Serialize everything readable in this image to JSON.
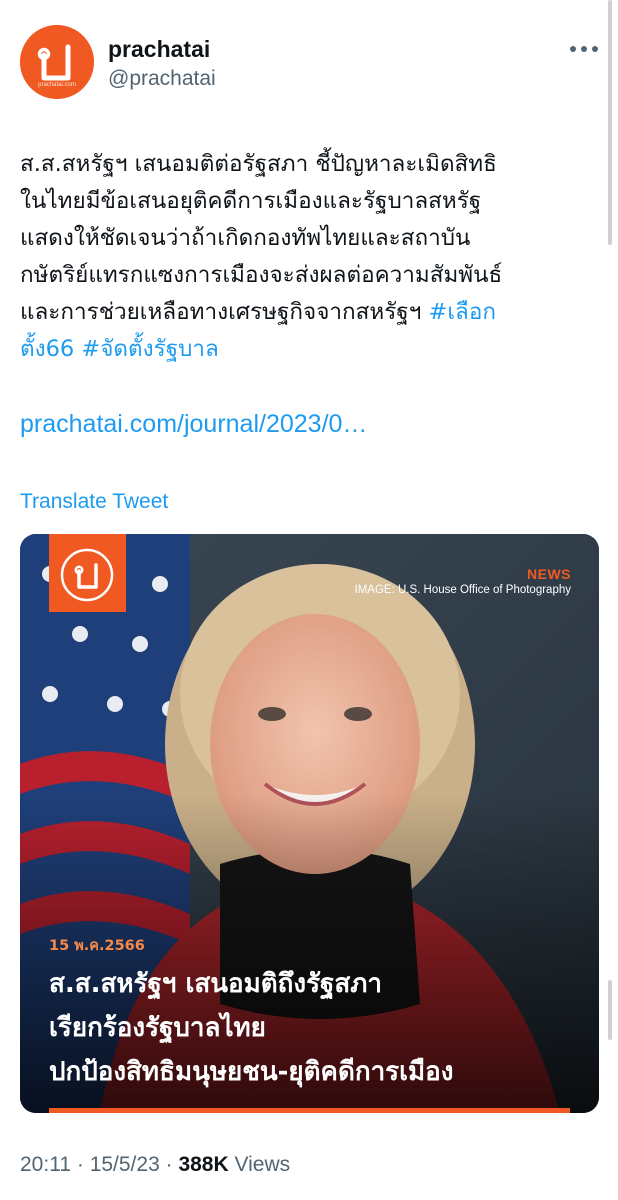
{
  "profile": {
    "name": "prachatai",
    "handle": "@prachatai",
    "avatar_glyph": "ป",
    "avatar_site": "prachatai.com",
    "brand_color": "#f05a22"
  },
  "tweet": {
    "lines": [
      "ส.ส.สหรัฐฯ เสนอมติต่อรัฐสภา ชี้ปัญหาละเมิดสิทธิ",
      "ในไทยมีข้อเสนอยุติคดีการเมืองและรัฐบาลสหรัฐ",
      "แสดงให้ชัดเจนว่าถ้าเกิดกองทัพไทยและสถาบัน",
      "กษัตริย์แทรกแซงการเมืองจะส่งผลต่อความสัมพันธ์"
    ],
    "line5_text": "และการช่วยเหลือทางเศรษฐกิจจากสหรัฐฯ ",
    "hashtag1_part1": "#เลือก",
    "hashtag1_part2": "ตั้ง66",
    "hashtag2": "#จัดตั้งรัฐบาล",
    "link": "prachatai.com/journal/2023/0…",
    "translate": "Translate Tweet"
  },
  "card": {
    "logo_glyph": "ป",
    "tag": "NEWS",
    "credit": "IMAGE: U.S. House Office of Photography",
    "date": "15 พ.ค.2566",
    "headline_lines": [
      "ส.ส.สหรัฐฯ เสนอมติถึงรัฐสภา",
      "เรียกร้องรัฐบาลไทย",
      "ปกป้องสิทธิมนุษยชน-ยุติคดีการเมือง"
    ]
  },
  "meta": {
    "time": "20:11",
    "separator": "·",
    "date": "15/5/23",
    "views_count": "388K",
    "views_label": "Views"
  },
  "icons": {
    "more": "more-horizontal-icon"
  }
}
